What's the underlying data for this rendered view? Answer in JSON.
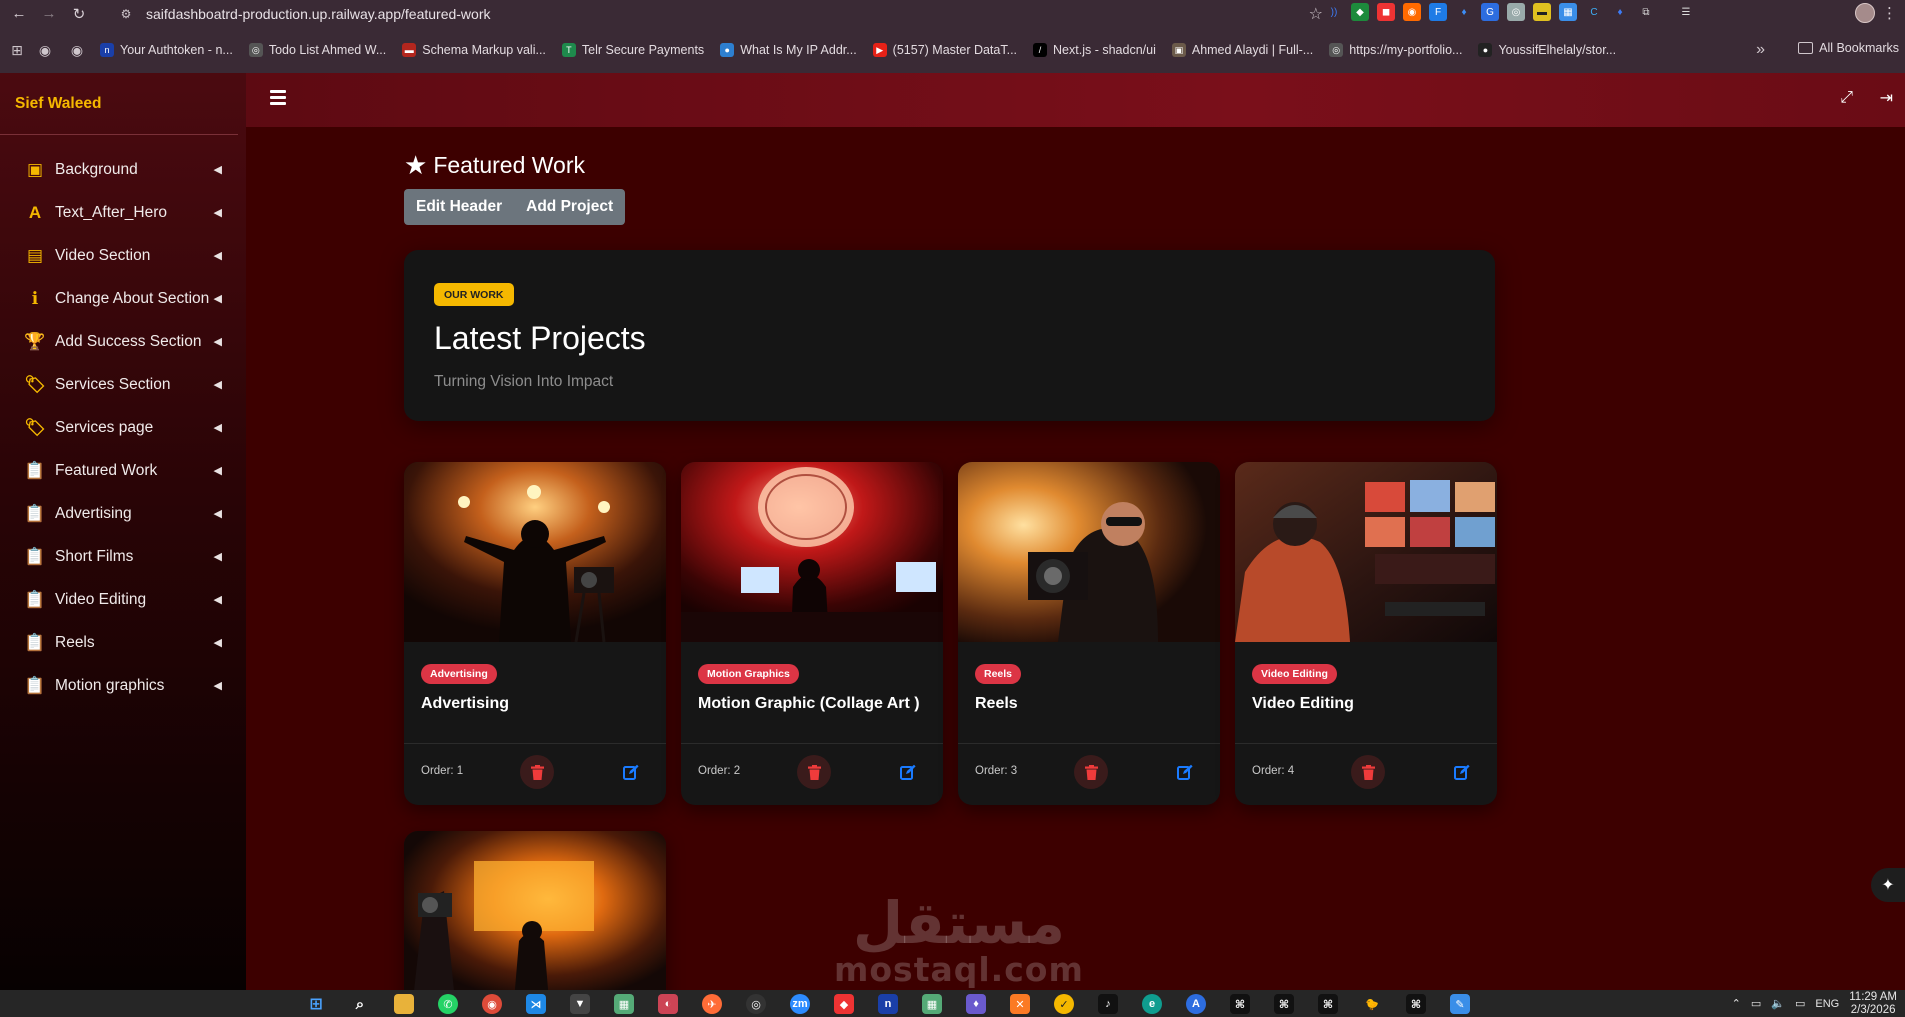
{
  "browser": {
    "url": "saifdashboatrd-production.up.railway.app/featured-work",
    "bookmarks": [
      {
        "label": "Your Authtoken - n...",
        "color": "#1a3fa8",
        "glyph": "n"
      },
      {
        "label": "Todo List Ahmed W...",
        "color": "#555555",
        "glyph": "◎"
      },
      {
        "label": "Schema Markup vali...",
        "color": "#b3261e",
        "glyph": "▬"
      },
      {
        "label": "Telr Secure Payments",
        "color": "#1e8a4c",
        "glyph": "T"
      },
      {
        "label": "What Is My IP Addr...",
        "color": "#2d7fd0",
        "glyph": "●"
      },
      {
        "label": "(5157) Master DataT...",
        "color": "#e62117",
        "glyph": "▶"
      },
      {
        "label": "Next.js - shadcn/ui",
        "color": "#000000",
        "glyph": "/"
      },
      {
        "label": "Ahmed Alaydi | Full-...",
        "color": "#6b5a4a",
        "glyph": "▣"
      },
      {
        "label": "https://my-portfolio...",
        "color": "#555555",
        "glyph": "◎"
      },
      {
        "label": "YoussifElhelaly/stor...",
        "color": "#222222",
        "glyph": "●"
      }
    ],
    "all_bookmarks_label": "All Bookmarks"
  },
  "sidebar": {
    "brand": "Sief Waleed",
    "items": [
      {
        "label": "Background",
        "icon": "image-icon",
        "glyph": "▣"
      },
      {
        "label": "Text_After_Hero",
        "icon": "font-icon",
        "glyph": "A"
      },
      {
        "label": "Video Section",
        "icon": "film-icon",
        "glyph": "▤"
      },
      {
        "label": "Change About Section",
        "icon": "info-icon",
        "glyph": "ℹ"
      },
      {
        "label": "Add Success Section",
        "icon": "trophy-icon",
        "glyph": "🏆"
      },
      {
        "label": "Services Section",
        "icon": "tags-icon",
        "glyph": "🏷"
      },
      {
        "label": "Services page",
        "icon": "tags-icon",
        "glyph": "🏷"
      },
      {
        "label": "Featured Work",
        "icon": "clipboard-icon",
        "glyph": "📋"
      },
      {
        "label": "Advertising",
        "icon": "clipboard-icon",
        "glyph": "📋"
      },
      {
        "label": "Short Films",
        "icon": "clipboard-icon",
        "glyph": "📋"
      },
      {
        "label": "Video Editing",
        "icon": "clipboard-icon",
        "glyph": "📋"
      },
      {
        "label": "Reels",
        "icon": "clipboard-icon",
        "glyph": "📋"
      },
      {
        "label": "Motion graphics",
        "icon": "clipboard-icon",
        "glyph": "📋"
      }
    ]
  },
  "page": {
    "title": "Featured Work",
    "buttons": {
      "edit_header": "Edit Header",
      "add_project": "Add Project"
    }
  },
  "hero": {
    "badge": "OUR WORK",
    "title": "Latest Projects",
    "subtitle": "Turning Vision Into Impact"
  },
  "projects": [
    {
      "tag": "Advertising",
      "title": "Advertising",
      "order": "Order: 1"
    },
    {
      "tag": "Motion Graphics",
      "title": "Motion Graphic (Collage Art )",
      "order": "Order: 2"
    },
    {
      "tag": "Reels",
      "title": "Reels",
      "order": "Order: 3"
    },
    {
      "tag": "Video Editing",
      "title": "Video Editing",
      "order": "Order: 4"
    }
  ],
  "watermark": {
    "arabic": "مستقل",
    "latin": "mostaql.com"
  },
  "taskbar": {
    "time": "11:29 AM",
    "date": "2/3/2026",
    "lang": "ENG"
  },
  "colors": {
    "accent": "#f5b800",
    "danger": "#dc3545",
    "edit": "#0d6efd",
    "background": "#3d0000"
  }
}
